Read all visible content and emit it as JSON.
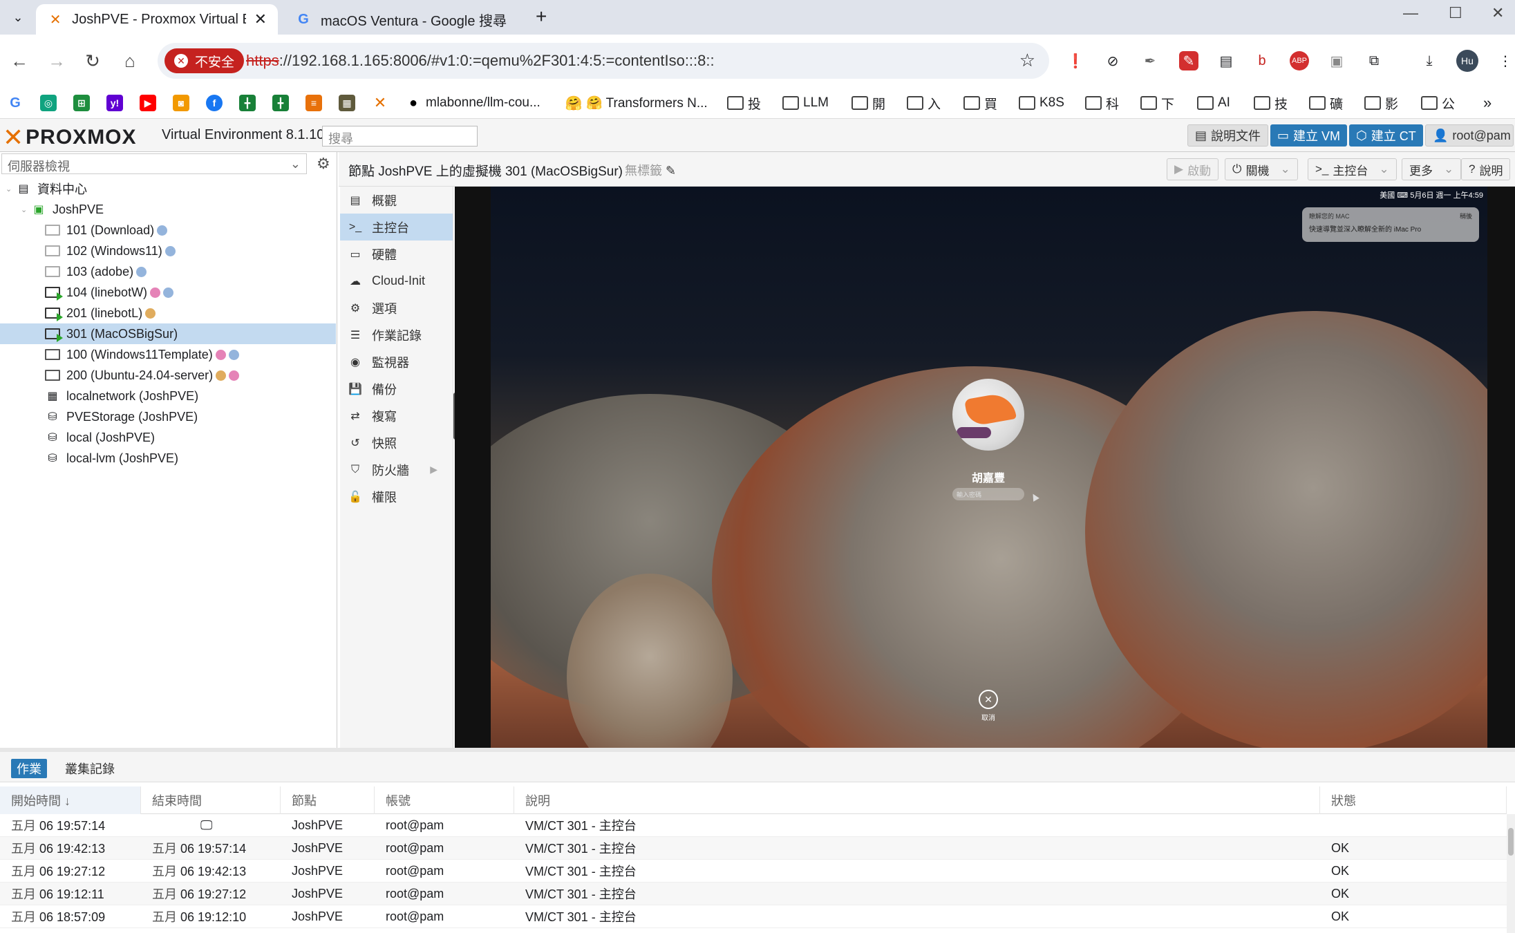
{
  "browser": {
    "tabs": [
      {
        "title": "JoshPVE - Proxmox Virtual En",
        "icon": "proxmox-icon",
        "active": true
      },
      {
        "title": "macOS Ventura - Google 搜尋",
        "icon": "google-icon",
        "active": false
      }
    ],
    "security_label": "不安全",
    "url_scheme": "https",
    "url_rest": "://192.168.1.165:8006/#v1:0:=qemu%2F301:4:5:=contentIso:::8::",
    "profile_initials": "Hu",
    "bookmarks": [
      {
        "label": "mlabonne/llm-cou...",
        "icon": "github-icon"
      },
      {
        "label": "🤗 Transformers N...",
        "icon": "huggingface-icon"
      },
      {
        "label": "投",
        "icon": "folder-icon"
      },
      {
        "label": "LLM",
        "icon": "folder-icon"
      },
      {
        "label": "開",
        "icon": "folder-icon"
      },
      {
        "label": "入",
        "icon": "folder-icon"
      },
      {
        "label": "買",
        "icon": "folder-icon"
      },
      {
        "label": "K8S",
        "icon": "folder-icon"
      },
      {
        "label": "科",
        "icon": "folder-icon"
      },
      {
        "label": "下",
        "icon": "folder-icon"
      },
      {
        "label": "AI",
        "icon": "folder-icon"
      },
      {
        "label": "技",
        "icon": "folder-icon"
      },
      {
        "label": "礦",
        "icon": "folder-icon"
      },
      {
        "label": "影",
        "icon": "folder-icon"
      },
      {
        "label": "公",
        "icon": "folder-icon"
      }
    ]
  },
  "pve": {
    "logo": "PROXMOX",
    "version": "Virtual Environment 8.1.10",
    "search_placeholder": "搜尋",
    "docs_label": "說明文件",
    "create_vm_label": "建立 VM",
    "create_ct_label": "建立 CT",
    "user_label": "root@pam",
    "view_selector": "伺服器檢視",
    "tree": {
      "datacenter": "資料中心",
      "node": "JoshPVE",
      "items": [
        {
          "label": "101 (Download)",
          "state": "off",
          "tags": [
            "blue"
          ]
        },
        {
          "label": "102 (Windows11)",
          "state": "off",
          "tags": [
            "blue"
          ]
        },
        {
          "label": "103 (adobe)",
          "state": "off",
          "tags": [
            "blue"
          ]
        },
        {
          "label": "104 (linebotW)",
          "state": "run",
          "tags": [
            "pink",
            "blue"
          ]
        },
        {
          "label": "201 (linebotL)",
          "state": "run",
          "tags": [
            "orange"
          ]
        },
        {
          "label": "301 (MacOSBigSur)",
          "state": "run",
          "tags": [],
          "selected": true
        },
        {
          "label": "100 (Windows11Template)",
          "state": "template",
          "tags": [
            "pink",
            "blue"
          ]
        },
        {
          "label": "200 (Ubuntu-24.04-server)",
          "state": "template",
          "tags": [
            "orange",
            "pink"
          ]
        },
        {
          "label": "localnetwork (JoshPVE)",
          "state": "network",
          "tags": []
        },
        {
          "label": "PVEStorage (JoshPVE)",
          "state": "storage",
          "tags": []
        },
        {
          "label": "local (JoshPVE)",
          "state": "storage",
          "tags": []
        },
        {
          "label": "local-lvm (JoshPVE)",
          "state": "storage",
          "tags": []
        }
      ]
    },
    "content": {
      "title": "節點 JoshPVE 上的虛擬機 301 (MacOSBigSur)",
      "no_tags": "無標籤",
      "start_label": "啟動",
      "shutdown_label": "關機",
      "console_label": "主控台",
      "more_label": "更多",
      "help_label": "說明",
      "menu": [
        {
          "label": "概觀",
          "icon": "book-icon"
        },
        {
          "label": "主控台",
          "icon": "terminal-icon",
          "selected": true
        },
        {
          "label": "硬體",
          "icon": "monitor-icon"
        },
        {
          "label": "Cloud-Init",
          "icon": "cloud-icon"
        },
        {
          "label": "選項",
          "icon": "gear-icon"
        },
        {
          "label": "作業記錄",
          "icon": "list-icon"
        },
        {
          "label": "監視器",
          "icon": "eye-icon"
        },
        {
          "label": "備份",
          "icon": "floppy-icon"
        },
        {
          "label": "複寫",
          "icon": "retweet-icon"
        },
        {
          "label": "快照",
          "icon": "history-icon"
        },
        {
          "label": "防火牆",
          "icon": "shield-icon",
          "submenu": true
        },
        {
          "label": "權限",
          "icon": "unlock-icon"
        }
      ]
    },
    "console": {
      "menubar_text": "美國  ⌨  5月6日 週一 上午4:59",
      "notif_title": "瞭解您的 MAC",
      "notif_body": "快速導覽並深入瞭解全新的 iMac Pro",
      "notif_action": "稍後",
      "user_name": "胡嘉豐",
      "password_placeholder": "輸入密碼",
      "cancel_label": "取消"
    },
    "tasks": {
      "tabs": [
        "作業",
        "叢集記錄"
      ],
      "columns": [
        "開始時間 ↓",
        "結束時間",
        "節點",
        "帳號",
        "說明",
        "狀態"
      ],
      "rows": [
        {
          "start_m": "五月",
          "start": "06 19:57:14",
          "end_m": "",
          "end": "",
          "running": true,
          "node": "JoshPVE",
          "user": "root@pam",
          "desc": "VM/CT 301 - 主控台",
          "status": ""
        },
        {
          "start_m": "五月",
          "start": "06 19:42:13",
          "end_m": "五月",
          "end": "06 19:57:14",
          "running": false,
          "node": "JoshPVE",
          "user": "root@pam",
          "desc": "VM/CT 301 - 主控台",
          "status": "OK"
        },
        {
          "start_m": "五月",
          "start": "06 19:27:12",
          "end_m": "五月",
          "end": "06 19:42:13",
          "running": false,
          "node": "JoshPVE",
          "user": "root@pam",
          "desc": "VM/CT 301 - 主控台",
          "status": "OK"
        },
        {
          "start_m": "五月",
          "start": "06 19:12:11",
          "end_m": "五月",
          "end": "06 19:27:12",
          "running": false,
          "node": "JoshPVE",
          "user": "root@pam",
          "desc": "VM/CT 301 - 主控台",
          "status": "OK"
        },
        {
          "start_m": "五月",
          "start": "06 18:57:09",
          "end_m": "五月",
          "end": "06 19:12:10",
          "running": false,
          "node": "JoshPVE",
          "user": "root@pam",
          "desc": "VM/CT 301 - 主控台",
          "status": "OK"
        }
      ]
    }
  }
}
